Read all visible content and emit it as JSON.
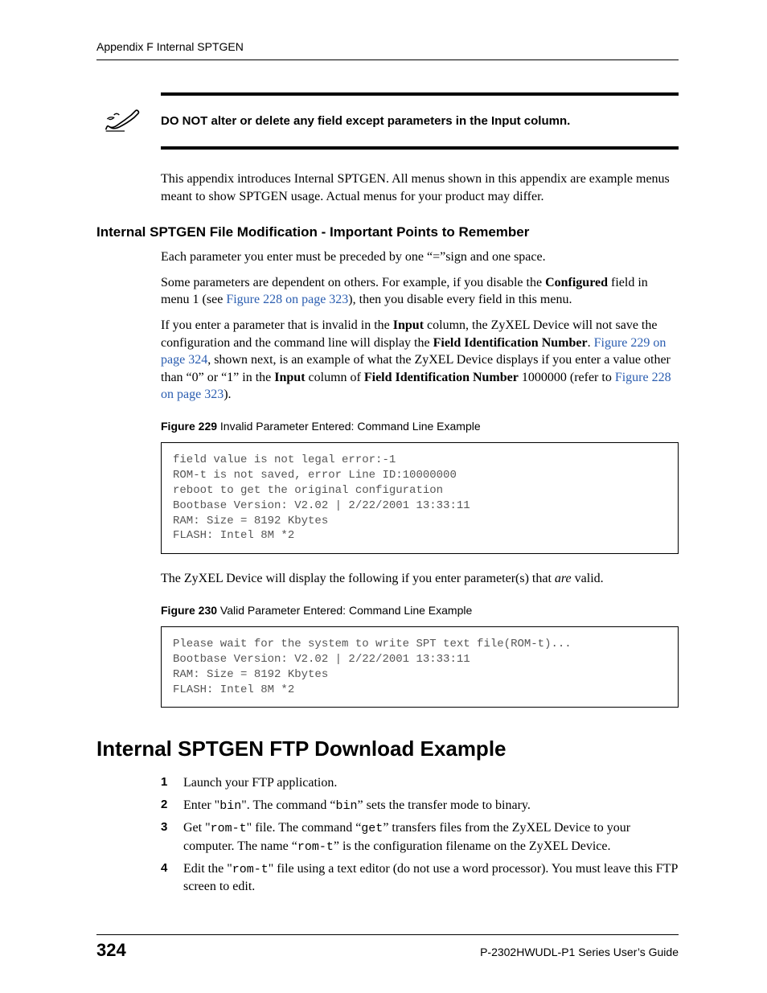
{
  "header": {
    "running": "Appendix F Internal SPTGEN"
  },
  "note": {
    "text": "DO NOT alter or delete any field except parameters in the Input column."
  },
  "intro": "This appendix introduces Internal SPTGEN. All menus shown in this appendix are example menus meant to show SPTGEN usage. Actual menus for your product may differ.",
  "sect1": {
    "heading": "Internal SPTGEN File Modification - Important Points to Remember",
    "p1": "Each parameter you enter must be preceded by one “=”sign and one space.",
    "p2a": "Some parameters are dependent on others. For example, if you disable the ",
    "p2_bold": "Configured",
    "p2b": " field in menu 1 (see ",
    "p2_link": "Figure 228 on page 323",
    "p2c": "), then you disable every field in this menu.",
    "p3a": "If you enter a parameter that is invalid in the ",
    "p3_b1": "Input",
    "p3b": " column, the ZyXEL Device will not save the configuration and the command line will display the ",
    "p3_b2": "Field Identification Number",
    "p3c": ". ",
    "p3_link1": "Figure 229 on page 324",
    "p3d": ", shown next, is an example of what the ZyXEL Device displays if you enter a value other than “0” or “1” in the ",
    "p3_b3": "Input",
    "p3e": " column of ",
    "p3_b4": "Field Identification Number",
    "p3f": " 1000000 (refer to ",
    "p3_link2": "Figure 228 on page 323",
    "p3g": ")."
  },
  "fig229": {
    "label": "Figure 229",
    "title": "   Invalid Parameter Entered: Command Line Example",
    "code": "field value is not legal error:-1\nROM-t is not saved, error Line ID:10000000\nreboot to get the original configuration\nBootbase Version: V2.02 | 2/22/2001 13:33:11\nRAM: Size = 8192 Kbytes\nFLASH: Intel 8M *2"
  },
  "mid_para_a": "The ZyXEL Device will display the following if you enter parameter(s) that ",
  "mid_para_i": "are",
  "mid_para_b": " valid.",
  "fig230": {
    "label": "Figure 230",
    "title": "   Valid Parameter Entered: Command Line Example",
    "code": "Please wait for the system to write SPT text file(ROM-t)...\nBootbase Version: V2.02 | 2/22/2001 13:33:11\nRAM: Size = 8192 Kbytes\nFLASH: Intel 8M *2"
  },
  "sect2": {
    "heading": "Internal SPTGEN FTP Download Example",
    "step1": "Launch your FTP application.",
    "step2a": "Enter \"",
    "step2m1": "bin",
    "step2b": "\". The command “",
    "step2m2": "bin",
    "step2c": "” sets the transfer mode to binary.",
    "step3a": "Get \"",
    "step3m1": "rom-t",
    "step3b": "\" file. The command “",
    "step3m2": "get",
    "step3c": "” transfers files from the ZyXEL Device to your computer. The name “",
    "step3m3": "rom-t",
    "step3d": "” is the configuration filename on the ZyXEL Device.",
    "step4a": "Edit the \"",
    "step4m1": "rom-t",
    "step4b": "\" file using a text editor (do not use a word processor). You must leave this FTP screen to edit."
  },
  "footer": {
    "page": "324",
    "title": "P-2302HWUDL-P1 Series User’s Guide"
  }
}
